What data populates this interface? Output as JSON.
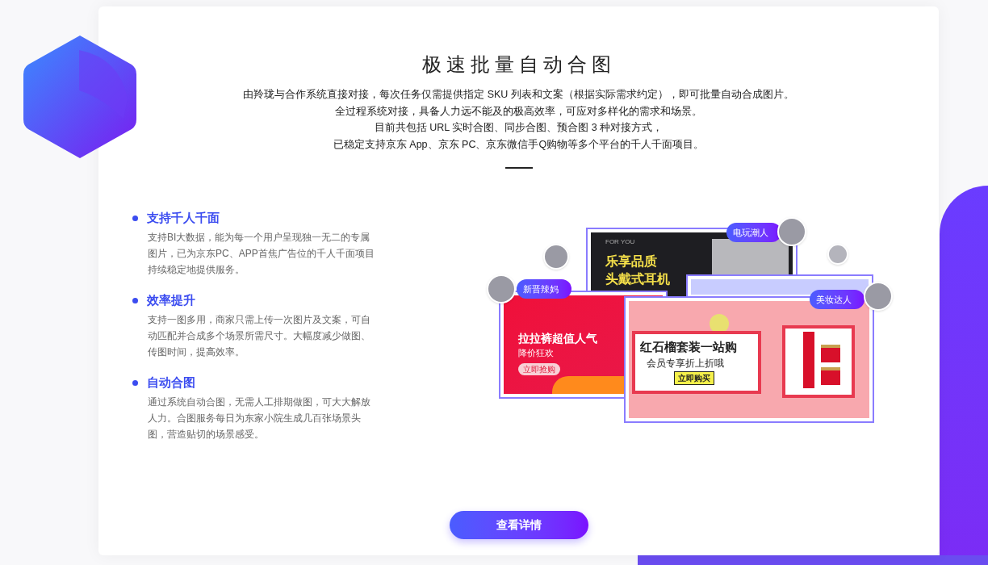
{
  "title": "极速批量自动合图",
  "intro": [
    "由羚珑与合作系统直接对接，每次任务仅需提供指定 SKU 列表和文案（根据实际需求约定），即可批量自动合成图片。",
    "全过程系统对接，具备人力远不能及的极高效率，可应对多样化的需求和场景。",
    "目前共包括 URL 实时合图、同步合图、预合图 3 种对接方式，",
    "已稳定支持京东 App、京东 PC、京东微信手Q购物等多个平台的千人千面项目。"
  ],
  "features": [
    {
      "title": "支持千人千面",
      "description": "支持BI大数据，能为每一个用户呈现独一无二的专属图片，已为京东PC、APP首焦广告位的千人千面项目持续稳定地提供服务。"
    },
    {
      "title": "效率提升",
      "description": "支持一图多用，商家只需上传一次图片及文案，可自动匹配并合成多个场景所需尺寸。大幅度减少做图、传图时间，提高效率。"
    },
    {
      "title": "自动合图",
      "description": "通过系统自动合图，无需人工排期做图，可大大解放人力。合图服务每日为东家小院生成几百张场景头图，营造贴切的场景感受。"
    }
  ],
  "collage": {
    "banners": [
      {
        "kind": "dark",
        "eyebrow": "FOR YOU",
        "headline": "乐享品质",
        "subline": "头戴式耳机"
      },
      {
        "kind": "grid"
      },
      {
        "kind": "red",
        "headline": "拉拉裤超值人气",
        "subline": "降价狂欢",
        "cta": "立即抢购"
      },
      {
        "kind": "pink",
        "headline": "红石榴套装一站购",
        "subline": "会员专享折上折哦",
        "cta": "立即购买"
      }
    ],
    "tags": [
      "电玩潮人",
      "新晋辣妈",
      "美妆达人"
    ]
  },
  "button": "查看详情"
}
